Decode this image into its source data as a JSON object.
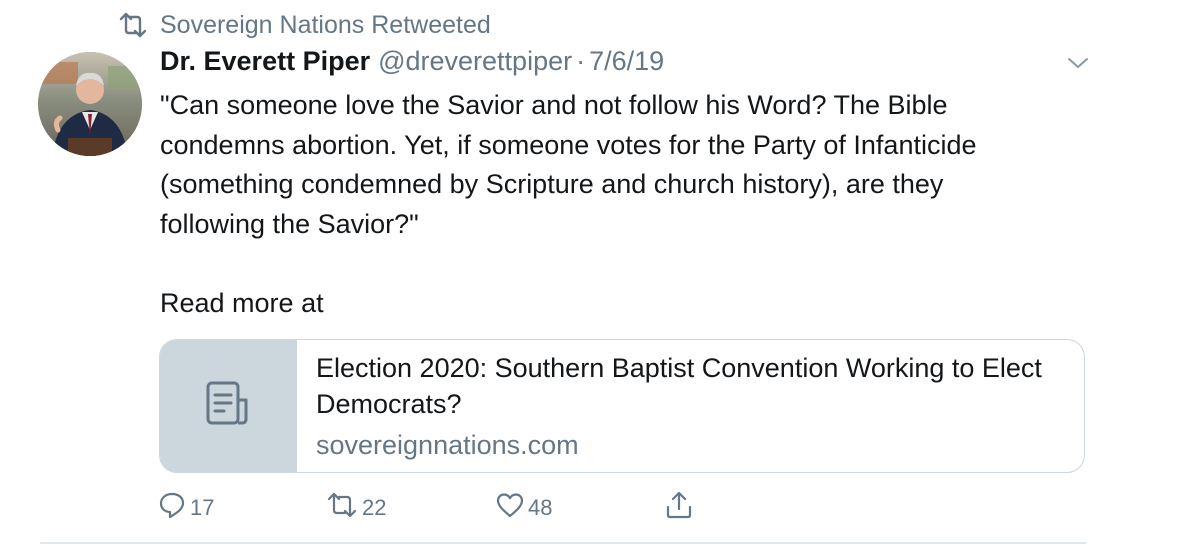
{
  "retweet_context": {
    "text": "Sovereign Nations Retweeted",
    "icon": "retweet-icon"
  },
  "author": {
    "name": "Dr. Everett Piper",
    "handle": "@dreverettpiper",
    "separator": "·",
    "date": "7/6/19",
    "avatar_icon": "avatar"
  },
  "tweet": {
    "lines": [
      "\"Can someone love the Savior and not follow his Word? The Bible",
      "condemns abortion. Yet, if someone votes for the Party of Infanticide",
      "(something condemned by Scripture and church history), are they",
      "following the Savior?\""
    ],
    "read_more": "Read more at"
  },
  "card": {
    "title": "Election 2020: Southern Baptist Convention Working to Elect Democrats?",
    "domain": "sovereignnations.com",
    "thumb_icon": "document-icon"
  },
  "actions": {
    "reply_count": "17",
    "retweet_count": "22",
    "like_count": "48",
    "share_icon": "share-icon"
  },
  "colors": {
    "text": "#14171a",
    "secondary": "#657786",
    "card_border": "#ccd6dd",
    "divider": "#e1e8ed"
  }
}
